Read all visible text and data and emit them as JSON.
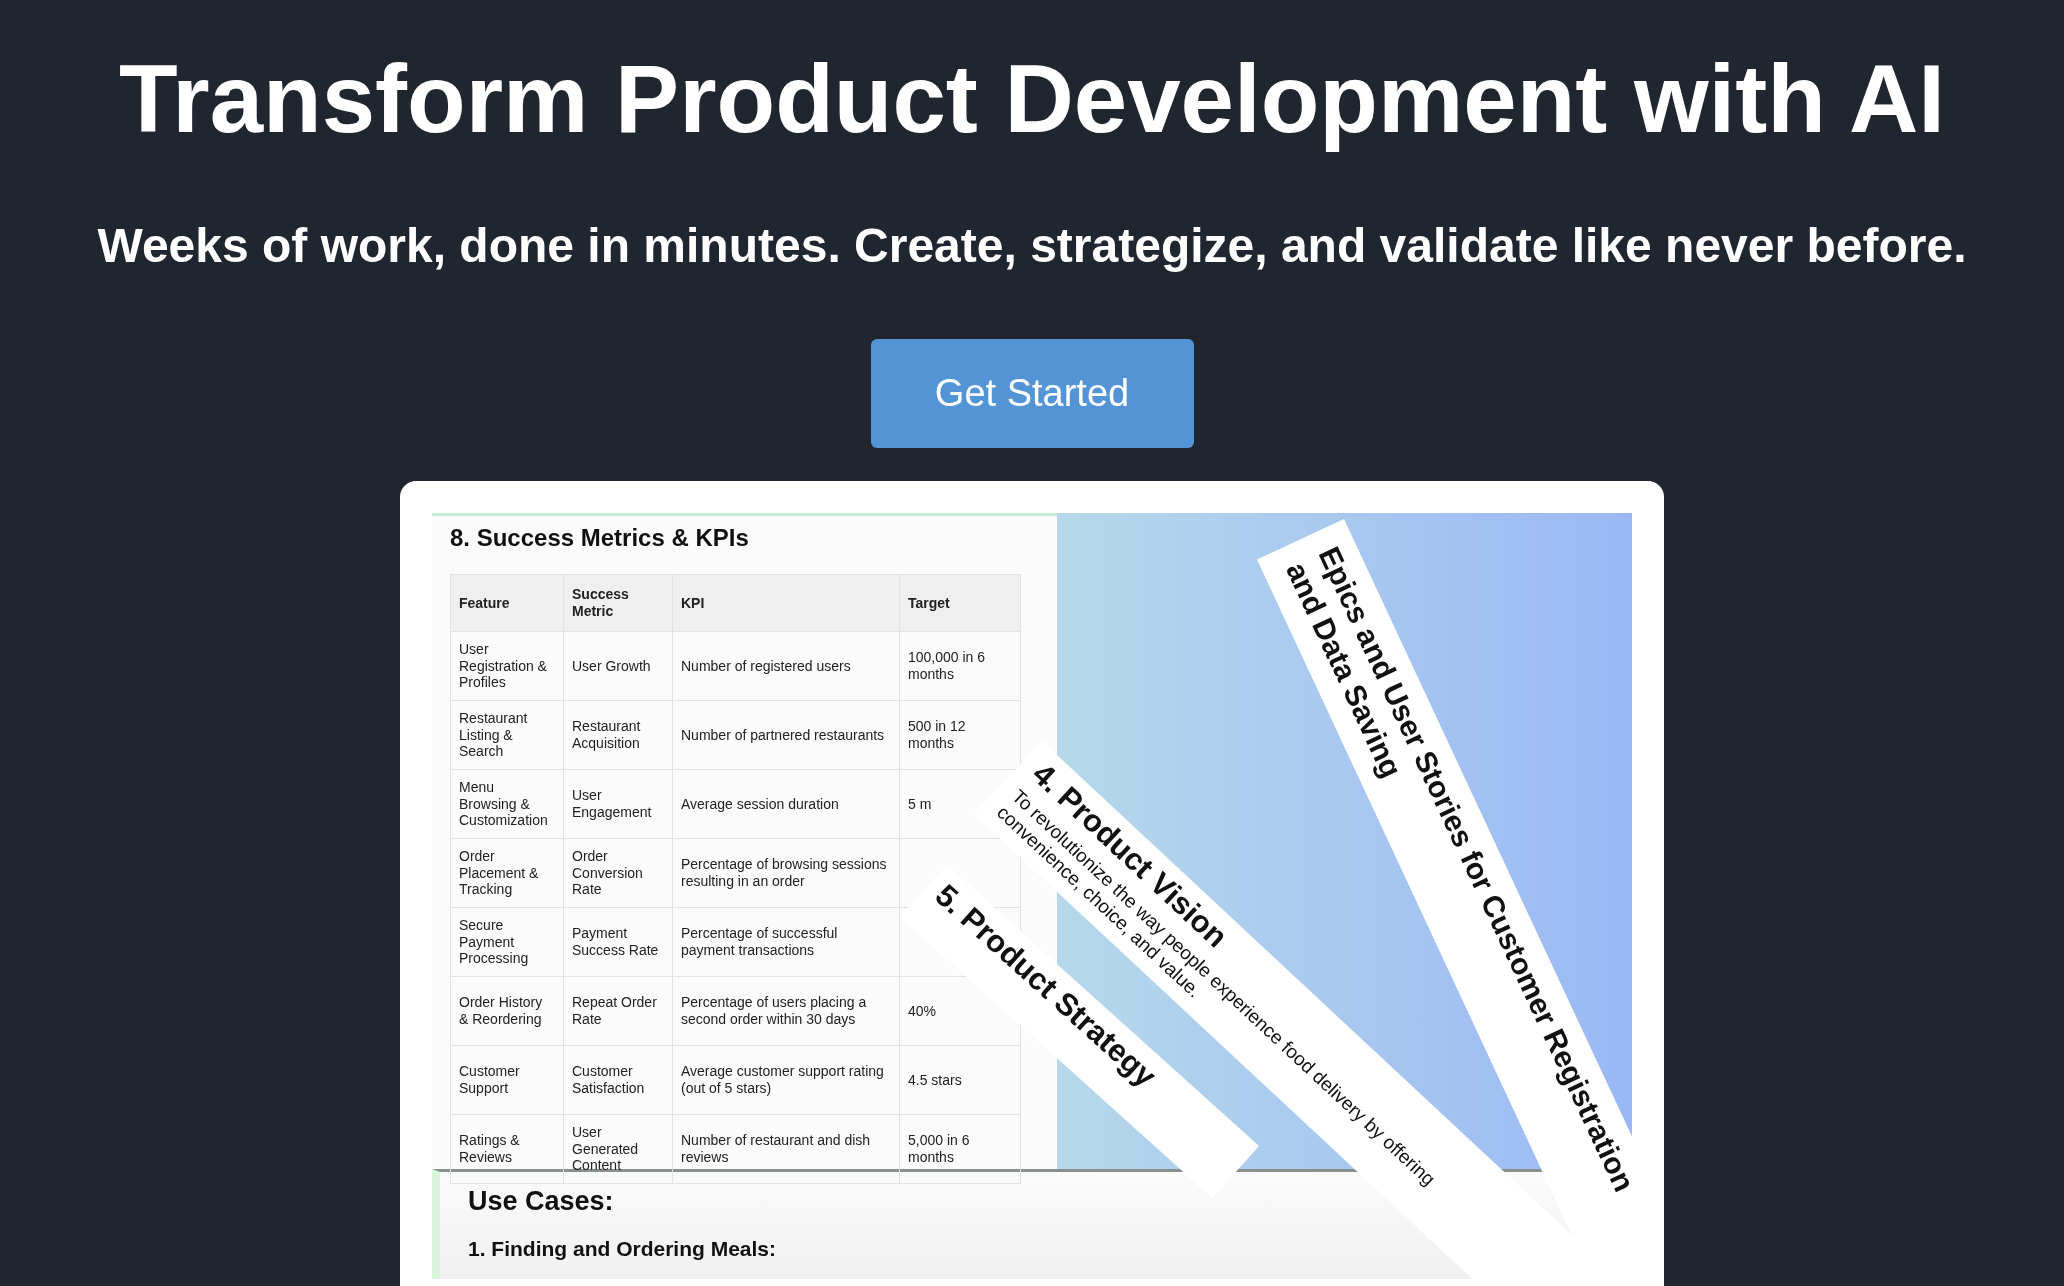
{
  "hero": {
    "title": "Transform Product Development with AI",
    "subtitle": "Weeks of work, done in minutes. Create, strategize, and validate like never before.",
    "button": "Get Started"
  },
  "preview": {
    "document": {
      "heading": "8. Success Metrics & KPIs",
      "table": {
        "columns": [
          "Feature",
          "Success Metric",
          "KPI",
          "Target"
        ],
        "rows": [
          {
            "feature": "User Registration & Profiles",
            "metric": "User Growth",
            "kpi": "Number of registered users",
            "target": "100,000 in 6 months"
          },
          {
            "feature": "Restaurant Listing & Search",
            "metric": "Restaurant Acquisition",
            "kpi": "Number of partnered restaurants",
            "target": "500 in 12 months"
          },
          {
            "feature": "Menu Browsing & Customization",
            "metric": "User Engagement",
            "kpi": "Average session duration",
            "target": "5 m"
          },
          {
            "feature": "Order Placement & Tracking",
            "metric": "Order Conversion Rate",
            "kpi": "Percentage of browsing sessions resulting in an order"
          },
          {
            "feature": "Secure Payment Processing",
            "metric": "Payment Success Rate",
            "kpi": "Percentage of successful payment transactions"
          },
          {
            "feature": "Order History & Reordering",
            "metric": "Repeat Order Rate",
            "kpi": "Percentage of users placing a second order within 30 days",
            "target": "40%"
          },
          {
            "feature": "Customer Support",
            "metric": "Customer Satisfaction",
            "kpi": "Average customer support rating (out of 5 stars)",
            "target": "4.5 stars"
          },
          {
            "feature": "Ratings & Reviews",
            "metric": "User Generated Content",
            "kpi": "Number of restaurant and dish reviews",
            "target": "5,000 in 6 months"
          }
        ]
      },
      "section_heading": "Use Cases:",
      "subheading": "1. Finding and Ordering Meals:"
    },
    "cards": [
      {
        "kind": "epics",
        "title_lines": [
          "Epics and User Stories for Customer Registration",
          "and Data Saving"
        ]
      },
      {
        "kind": "vision",
        "heading": "4. Product Vision",
        "text_lines": [
          "To revolutionize the way people experience food delivery by offering",
          "convenience, choice, and value."
        ]
      },
      {
        "kind": "strategy",
        "heading": "5. Product Strategy"
      }
    ]
  }
}
